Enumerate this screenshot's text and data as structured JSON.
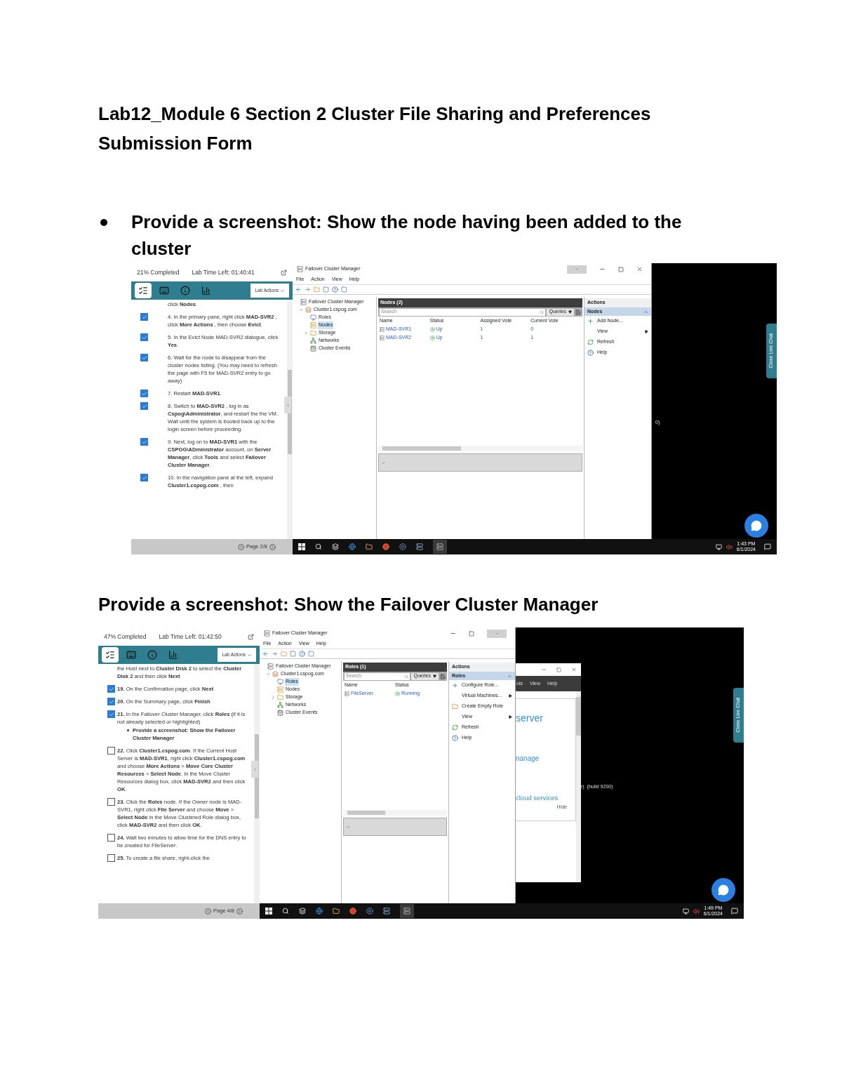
{
  "title": "Lab12_Module 6 Section 2  Cluster File Sharing and Preferences Submission Form",
  "sections": [
    {
      "kind": "bullet",
      "heading": "Provide a screenshot: Show the node having been added to the cluster",
      "screenshot": {
        "lab_panel": {
          "progress": "21% Completed",
          "time_left": "Lab Time Left: 01:40:41",
          "tabs": [
            {
              "kind": "steps",
              "selected": true
            },
            {
              "kind": "keyboard",
              "selected": false
            },
            {
              "kind": "info",
              "selected": false
            },
            {
              "kind": "chart",
              "selected": false
            }
          ],
          "lab_actions": "Lab Actions",
          "steps": [
            {
              "kind": "text",
              "text": "click **Nodes**."
            },
            {
              "kind": "task",
              "checked": true,
              "text": "4. In the primary pane, right click **MAD-SVR2** , click **More Actions** , then choose **Evict**."
            },
            {
              "kind": "task",
              "checked": true,
              "text": "5. In the Evict Node MAD-SVR2 dialogue, click **Yes**."
            },
            {
              "kind": "task",
              "checked": true,
              "text": "6. Wait for the node to disappear from the cluster nodes listing. (You may need to refresh the page with F5 for MAD-SVR2 entry to go away)"
            },
            {
              "kind": "task",
              "checked": true,
              "text": "7. Restart **MAD-SVR1**."
            },
            {
              "kind": "task",
              "checked": true,
              "text": "8. Switch to **MAD-SVR2** , log in as **Cspog\\Administrator**, and restart the the VM. Wait until the system is booted back up to the login screen before proceeding."
            },
            {
              "kind": "task",
              "checked": true,
              "text": "9. Next, log on to **MAD-SVR1** with the **CSPOG\\ADministrator** account, on **Server Manager**, click **Tools** and select **Failover Cluster Manager**."
            },
            {
              "kind": "task",
              "checked": true,
              "text": "10. In the navigation pane at the left, expand **Cluster1.cspog.com** , then"
            }
          ],
          "page": "Page 2/8"
        },
        "fcm": {
          "title": "Failover Cluster Manager",
          "controls": [
            {
              "kind": "tab"
            },
            {
              "kind": "minimize"
            },
            {
              "kind": "maximize"
            },
            {
              "kind": "close"
            }
          ],
          "menu": [
            "File",
            "Action",
            "View",
            "Help"
          ],
          "tree": [
            {
              "label": "Failover Cluster Manager",
              "kind": "manager",
              "selected": false,
              "children": [
                {
                  "label": "Cluster1.cspog.com",
                  "kind": "cluster",
                  "selected": false,
                  "expanded": true,
                  "children": [
                    {
                      "label": "Roles",
                      "kind": "roles",
                      "selected": false
                    },
                    {
                      "label": "Nodes",
                      "kind": "nodes",
                      "selected": true
                    },
                    {
                      "label": "Storage",
                      "kind": "storage",
                      "selected": false,
                      "expanded": false
                    },
                    {
                      "label": "Networks",
                      "kind": "networks",
                      "selected": false
                    },
                    {
                      "label": "Cluster Events",
                      "kind": "events",
                      "selected": false
                    }
                  ]
                }
              ]
            }
          ],
          "list": {
            "title": "Nodes (2)",
            "search_placeholder": "Search",
            "queries": "Queries",
            "columns": [
              {
                "label": "Name",
                "kind": "name"
              },
              {
                "label": "Status",
                "kind": "status"
              },
              {
                "label": "Assigned Vote",
                "kind": "plain"
              },
              {
                "label": "Current Vote",
                "kind": "plain"
              }
            ],
            "rows": [
              {
                "cells": [
                  "MAD-SVR1",
                  "Up",
                  "1",
                  "0"
                ]
              },
              {
                "cells": [
                  "MAD-SVR2",
                  "Up",
                  "1",
                  "1"
                ]
              }
            ]
          },
          "actions": {
            "title": "Actions",
            "section": "Nodes",
            "items": [
              {
                "label": "Add Node...",
                "kind": "add",
                "submenu": false
              },
              {
                "label": "View",
                "kind": "none",
                "submenu": true
              },
              {
                "label": "Refresh",
                "kind": "refresh",
                "submenu": false
              },
              {
                "label": "Help",
                "kind": "help",
                "submenu": false
              }
            ]
          }
        },
        "desktop": {
          "texts": [
            "0)"
          ],
          "chat_tab": "Close Live Chat"
        },
        "taskbar": {
          "time": "1:43 PM",
          "date": "6/1/2024"
        }
      }
    },
    {
      "kind": "plain",
      "heading": "Provide a screenshot: Show the Failover Cluster Manager",
      "screenshot": {
        "lab_panel": {
          "progress": "47% Completed",
          "time_left": "Lab Time Left: 01:42:50",
          "tabs": [
            {
              "kind": "steps",
              "selected": true
            },
            {
              "kind": "keyboard",
              "selected": false
            },
            {
              "kind": "info",
              "selected": false
            },
            {
              "kind": "chart",
              "selected": false
            }
          ],
          "lab_actions": "Lab Actions",
          "steps": [
            {
              "kind": "text",
              "text": "the Host next to **Cluster Disk 2** to select the **Cluster Disk 2** and then click **Next**"
            },
            {
              "kind": "task",
              "checked": true,
              "text": "**19.** On the Confirmation page, click **Next**"
            },
            {
              "kind": "task",
              "checked": true,
              "text": "**20.** On the Summary page, click **Finish**"
            },
            {
              "kind": "task",
              "checked": true,
              "text": "**21.** In the Failover Cluster Manager, click **Roles** (if it is not already selected or highlighted)",
              "children": [
                "Provide a screenshot: Show the Failover Cluster Manager"
              ]
            },
            {
              "kind": "task",
              "checked": false,
              "text": "**22.** Click **Cluster1.cspog.com**. If the Current Host Server is **MAD-SVR1**, right click **Cluster1.cspog.com** and choose **More Actions** > **Move Core Cluster Resources** > **Select Node**. In the Move Cluster Resources dialog box, click **MAD-SVR2** and then click **OK**."
            },
            {
              "kind": "task",
              "checked": false,
              "text": "**23.** Click the **Roles** node. If the Owner node is MAD-SVR1, right click **File Server** and choose **Move** > **Select Node** in the Move Clustered Role dialog box, click **MAD-SVR2** and then click **OK**."
            },
            {
              "kind": "task",
              "checked": false,
              "text": "**24.** Wait two minutes to allow time for the DNS entry to be created for FileServer."
            },
            {
              "kind": "task",
              "checked": false,
              "text": "**25.** To create a file share, right-click the"
            }
          ],
          "page": "Page 4/8"
        },
        "fcm": {
          "title": "Failover Cluster Manager",
          "controls": [
            {
              "kind": "minimize"
            },
            {
              "kind": "maximize"
            },
            {
              "kind": "tab"
            }
          ],
          "menu": [
            "File",
            "Action",
            "View",
            "Help"
          ],
          "tree": [
            {
              "label": "Failover Cluster Manager",
              "kind": "manager",
              "selected": false,
              "children": [
                {
                  "label": "Cluster1.cspog.com",
                  "kind": "cluster",
                  "selected": false,
                  "expanded": true,
                  "children": [
                    {
                      "label": "Roles",
                      "kind": "roles",
                      "selected": true
                    },
                    {
                      "label": "Nodes",
                      "kind": "nodes",
                      "selected": false
                    },
                    {
                      "label": "Storage",
                      "kind": "storage",
                      "selected": false,
                      "expanded": false
                    },
                    {
                      "label": "Networks",
                      "kind": "networks",
                      "selected": false
                    },
                    {
                      "label": "Cluster Events",
                      "kind": "events",
                      "selected": false
                    }
                  ]
                }
              ]
            }
          ],
          "list": {
            "title": "Roles (1)",
            "search_placeholder": "Search",
            "queries": "Queries",
            "columns": [
              {
                "label": "Name",
                "kind": "name"
              },
              {
                "label": "Status",
                "kind": "status"
              }
            ],
            "rows": [
              {
                "cells": [
                  "FileServer",
                  "Running"
                ]
              }
            ]
          },
          "actions": {
            "title": "Actions",
            "section": "Roles",
            "items": [
              {
                "label": "Configure Role...",
                "kind": "add",
                "submenu": false
              },
              {
                "label": "Virtual Machines...",
                "kind": "none",
                "submenu": true
              },
              {
                "label": "Create Empty Role",
                "kind": "create",
                "submenu": false
              },
              {
                "label": "View",
                "kind": "none",
                "submenu": true
              },
              {
                "label": "Refresh",
                "kind": "refresh",
                "submenu": false
              },
              {
                "label": "Help",
                "kind": "help",
                "submenu": false
              }
            ]
          }
        },
        "server_manager": {
          "menu": [
            "ols",
            "View",
            "Help"
          ],
          "texts": [
            "server",
            "nanage",
            "cloud services"
          ],
          "hide": "Hide"
        },
        "desktop": {
          "texts": [
            "r)  (build 9200)"
          ],
          "chat_tab": "Close Live Chat"
        },
        "taskbar": {
          "time": "1:49 PM",
          "date": "6/1/2024"
        }
      }
    }
  ]
}
